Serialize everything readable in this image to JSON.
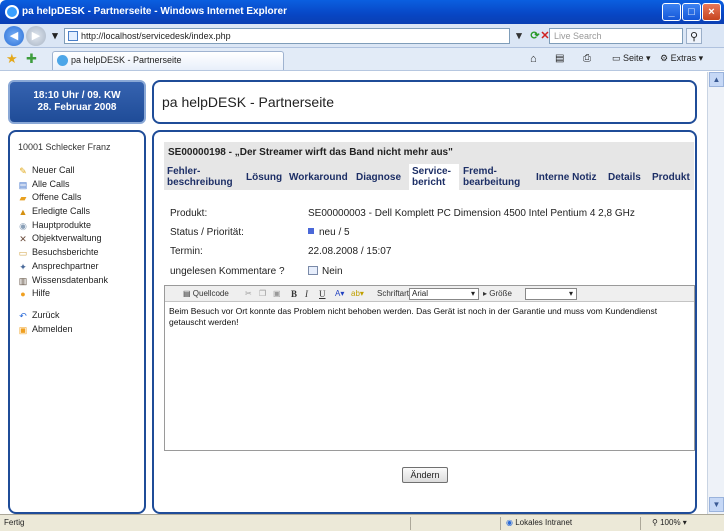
{
  "window": {
    "title": "pa helpDESK - Partnerseite - Windows Internet Explorer",
    "min": "_",
    "max": "□",
    "close": "×"
  },
  "browser": {
    "url": "http://localhost/servicedesk/index.php",
    "search_placeholder": "Live Search",
    "tab_title": "pa helpDESK - Partnerseite",
    "cmd_page": "Seite",
    "cmd_extras": "Extras"
  },
  "header": {
    "date_line1": "18:10 Uhr / 09. KW",
    "date_line2": "28. Februar 2008",
    "app_title": "pa helpDESK - Partnerseite"
  },
  "sidebar": {
    "user": "10001 Schlecker Franz",
    "items": [
      {
        "label": "Neuer Call",
        "icon": "pencil-icon",
        "glyph": "✎",
        "color": "#e0a818"
      },
      {
        "label": "Alle Calls",
        "icon": "list-icon",
        "glyph": "▤",
        "color": "#3a6ec8"
      },
      {
        "label": "Offene Calls",
        "icon": "open-folder-icon",
        "glyph": "▰",
        "color": "#e8a020"
      },
      {
        "label": "Erledigte Calls",
        "icon": "lock-icon",
        "glyph": "▲",
        "color": "#d49010"
      },
      {
        "label": "Hauptprodukte",
        "icon": "cd-icon",
        "glyph": "◉",
        "color": "#8aa0b8"
      },
      {
        "label": "Objektverwaltung",
        "icon": "tools-icon",
        "glyph": "✕",
        "color": "#6a4a3a"
      },
      {
        "label": "Besuchsberichte",
        "icon": "document-icon",
        "glyph": "▭",
        "color": "#d0a040"
      },
      {
        "label": "Ansprechpartner",
        "icon": "contact-icon",
        "glyph": "✦",
        "color": "#4a6a9a"
      },
      {
        "label": "Wissensdatenbank",
        "icon": "books-icon",
        "glyph": "▥",
        "color": "#5a4a3a"
      },
      {
        "label": "Hilfe",
        "icon": "help-icon",
        "glyph": "●",
        "color": "#f0a020"
      }
    ],
    "items2": [
      {
        "label": "Zurück",
        "icon": "back-arrow-icon",
        "glyph": "↶",
        "color": "#2a6ad8"
      },
      {
        "label": "Abmelden",
        "icon": "logout-icon",
        "glyph": "▣",
        "color": "#f0a020"
      }
    ]
  },
  "case": {
    "title": "SE00000198 - „Der Streamer wirft das Band nicht mehr aus\"",
    "tabs": [
      {
        "label": "Fehler-\nbeschreibung",
        "active": false
      },
      {
        "label": "Lösung",
        "active": false
      },
      {
        "label": "Workaround",
        "active": false
      },
      {
        "label": "Diagnose",
        "active": false
      },
      {
        "label": "Service-\nbericht",
        "active": true
      },
      {
        "label": "Fremd-\nbearbeitung",
        "active": false
      },
      {
        "label": "Interne Notiz",
        "active": false
      },
      {
        "label": "Details",
        "active": false
      },
      {
        "label": "Produkt",
        "active": false
      }
    ],
    "product_label": "Produkt:",
    "product_value": "SE00000003 - Dell Komplett PC Dimension 4500 Intel Pentium 4 2,8 GHz",
    "status_label": "Status / Priorität:",
    "status_value": "neu / 5",
    "date_label": "Termin:",
    "date_value": "22.08.2008 / 15:07",
    "comments_label": "ungelesen Kommentare ?",
    "comments_value": "Nein"
  },
  "editor": {
    "source": "Quellcode",
    "font_label": "Schriftart",
    "font_value": "Arial",
    "size_label": "Größe",
    "size_value": "",
    "text": "Beim Besuch vor Ort konnte das Problem nicht behoben werden. Das Gerät ist noch in der Garantie und muss vom Kundendienst getauscht werden!",
    "save_label": "Ändern"
  },
  "statusbar": {
    "left": "Fertig",
    "zone": "Lokales Intranet",
    "zoom": "100%"
  }
}
